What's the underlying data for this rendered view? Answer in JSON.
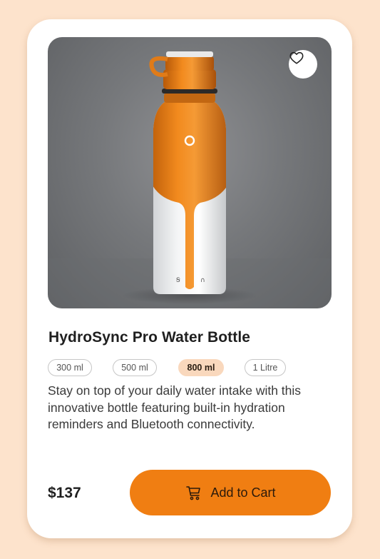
{
  "product": {
    "title": "HydroSync Pro Water Bottle",
    "description": "Stay on top of your daily water intake with this innovative bottle featuring built-in hydration reminders and  Bluetooth connectivity.",
    "price": "$137",
    "image": "orange-and-white-smart-water-bottle",
    "favorite_icon": "heart-outline-icon",
    "sizes": [
      {
        "label": "300 ml",
        "selected": false
      },
      {
        "label": "500 ml",
        "selected": false
      },
      {
        "label": "800 ml",
        "selected": true
      },
      {
        "label": "1 Litre",
        "selected": false
      }
    ]
  },
  "cart_button": {
    "label": "Add to Cart",
    "icon": "cart-icon"
  },
  "colors": {
    "background": "#fde3cc",
    "accent": "#f07e12",
    "selected_chip": "#f9d8bd",
    "card": "#ffffff"
  }
}
